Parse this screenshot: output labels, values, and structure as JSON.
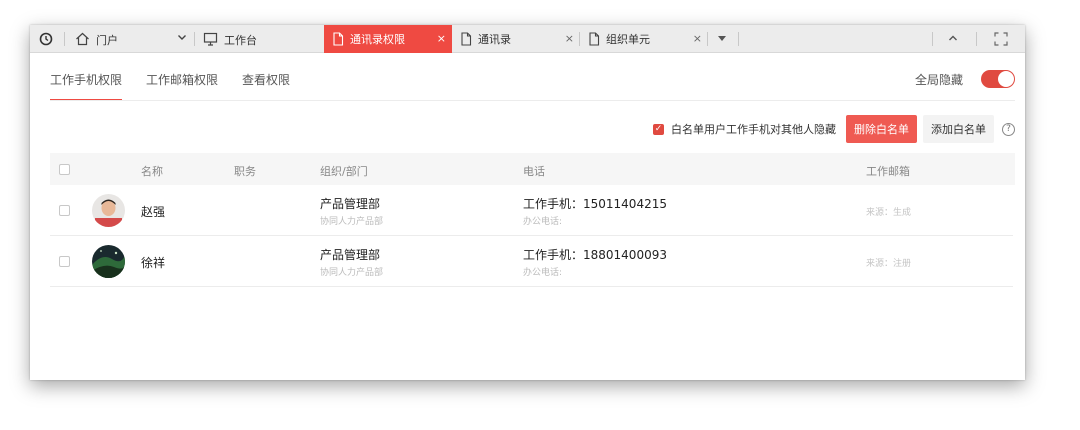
{
  "tabbar": {
    "home_label": "门户",
    "workbench_label": "工作台",
    "tabs": [
      {
        "label": "通讯录权限",
        "active": true
      },
      {
        "label": "通讯录",
        "active": false
      },
      {
        "label": "组织单元",
        "active": false
      }
    ],
    "close_glyph": "×"
  },
  "subtabs": [
    "工作手机权限",
    "工作邮箱权限",
    "查看权限"
  ],
  "global_hide": {
    "label": "全局隐藏",
    "on": true
  },
  "actions": {
    "whitelist_checkbox_label": "白名单用户工作手机对其他人隐藏",
    "whitelist_checked": true,
    "delete_button": "删除白名单",
    "add_button": "添加白名单",
    "help_glyph": "?"
  },
  "table": {
    "headers": {
      "name": "名称",
      "position": "职务",
      "dept": "组织/部门",
      "phone": "电话",
      "mail": "工作邮箱"
    },
    "rows": [
      {
        "name": "赵强",
        "dept": "产品管理部",
        "dept_sub": "协同人力产品部",
        "phone": "工作手机：15011404215",
        "phone_sub": "办公电话:",
        "mail": "来源：生成"
      },
      {
        "name": "徐祥",
        "dept": "产品管理部",
        "dept_sub": "协同人力产品部",
        "phone": "工作手机：18801400093",
        "phone_sub": "办公电话:",
        "mail": "来源：注册"
      }
    ]
  },
  "colors": {
    "accent": "#ef4a42",
    "tabbar_bg": "#ececec"
  }
}
